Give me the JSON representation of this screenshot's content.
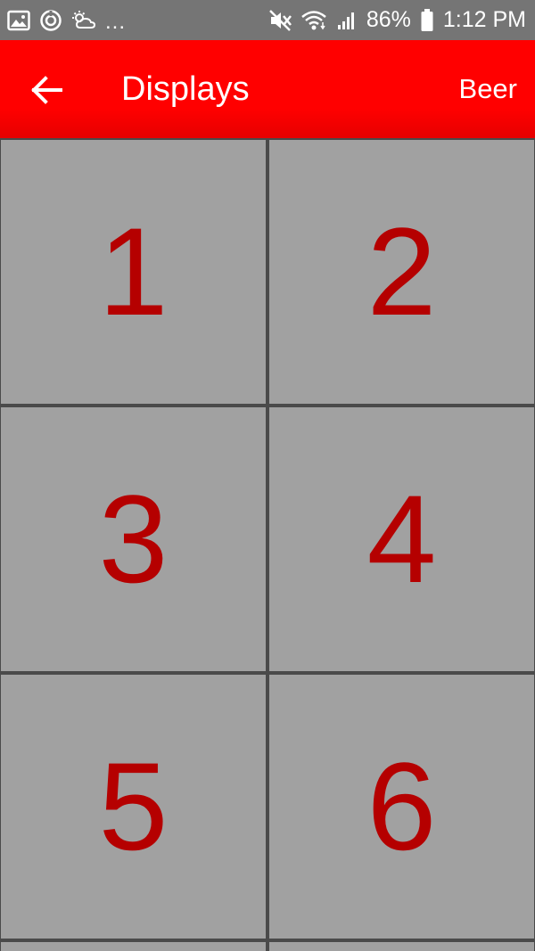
{
  "status_bar": {
    "left_icons": [
      "gallery-icon",
      "sync-icon",
      "weather-icon"
    ],
    "overflow": "...",
    "right_icons": [
      "mute-icon",
      "wifi-icon",
      "signal-icon"
    ],
    "battery_percent": "86%",
    "time": "1:12 PM",
    "battery_icon": "battery-icon"
  },
  "app_bar": {
    "back_icon": "arrow-left-icon",
    "title": "Displays",
    "action": "Beer"
  },
  "grid": {
    "tiles": [
      {
        "label": "1"
      },
      {
        "label": "2"
      },
      {
        "label": "3"
      },
      {
        "label": "4"
      },
      {
        "label": "5"
      },
      {
        "label": "6"
      }
    ]
  },
  "colors": {
    "app_bar": "#ff0000",
    "status_bar": "#757575",
    "tile_bg": "#a1a1a1",
    "tile_text": "#b50000",
    "divider": "#4a4a4a"
  }
}
